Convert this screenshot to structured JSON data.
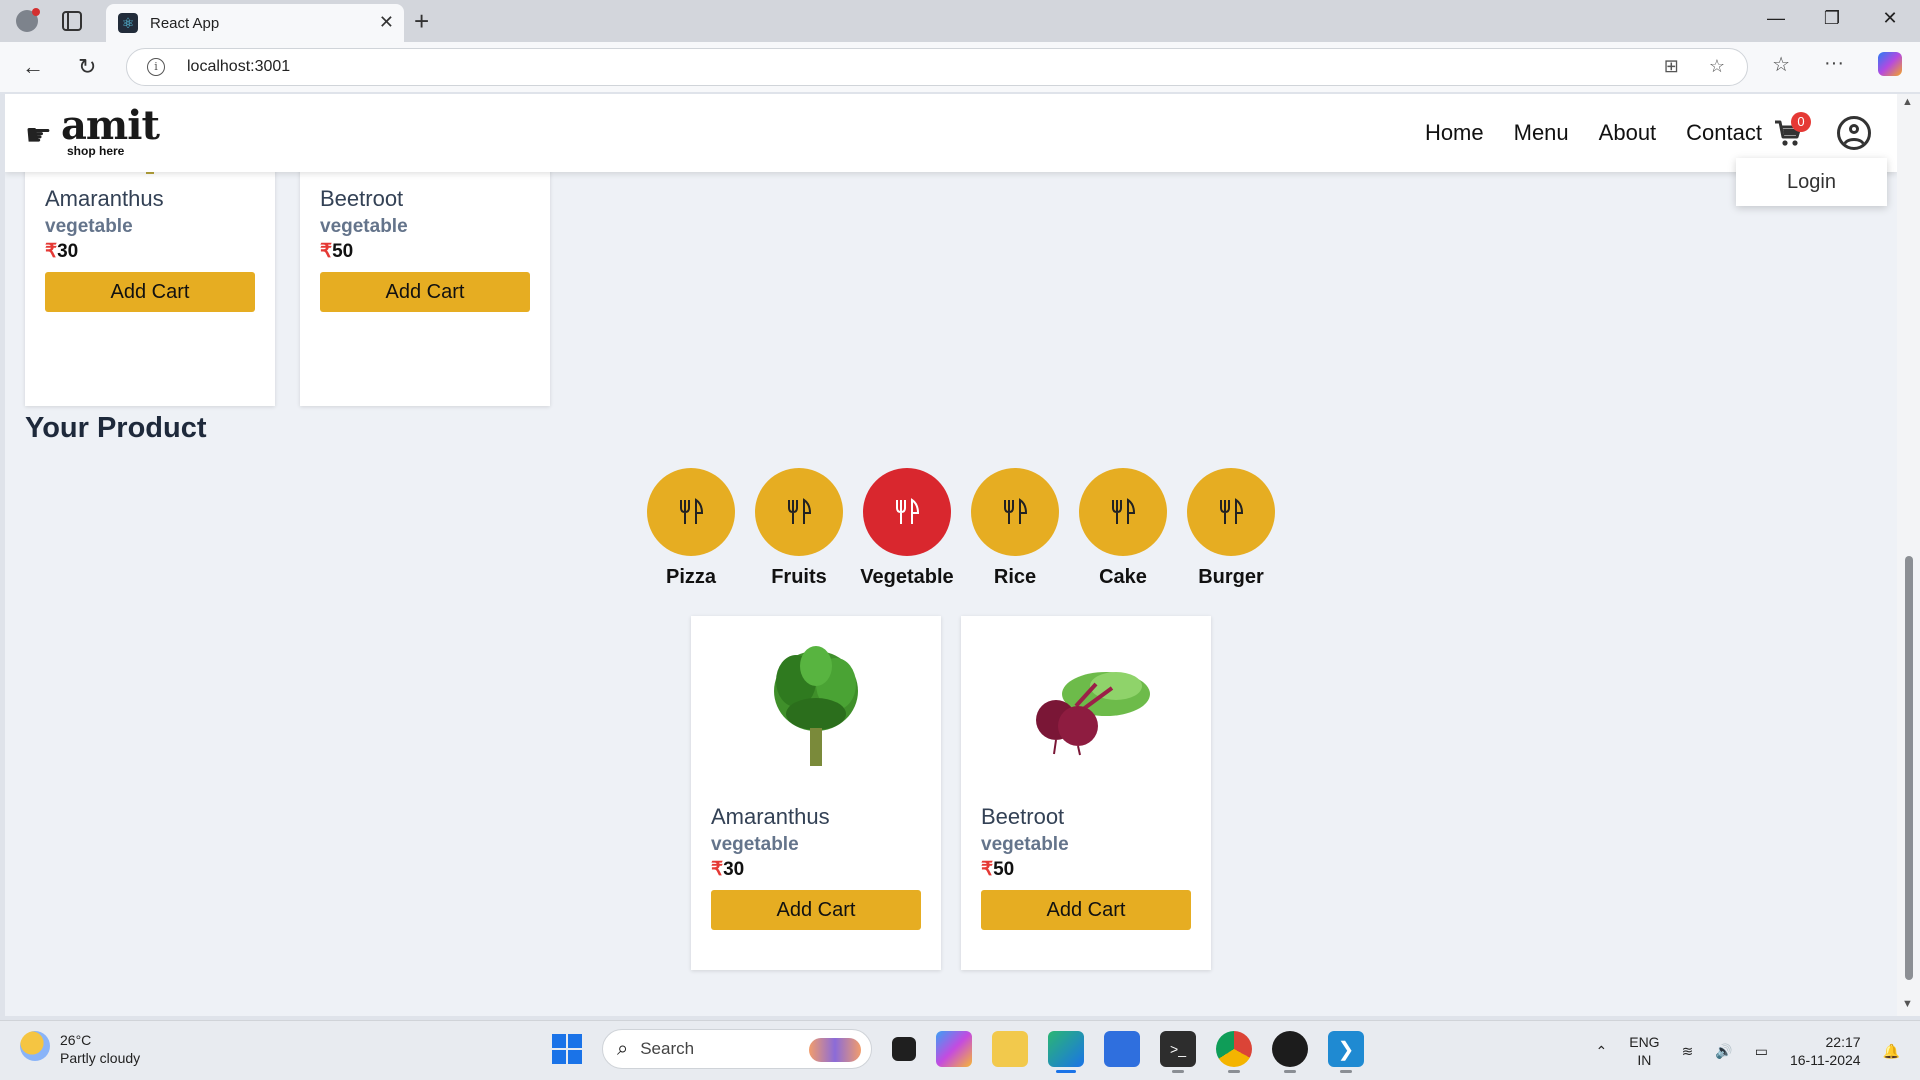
{
  "browser": {
    "tab_title": "React App",
    "url": "localhost:3001"
  },
  "header": {
    "logo_text": "amit",
    "logo_subtitle": "shop here",
    "nav": [
      "Home",
      "Menu",
      "About",
      "Contact"
    ],
    "cart_count": "0",
    "login_label": "Login"
  },
  "top_products": [
    {
      "name": "Amaranthus",
      "category": "vegetable",
      "currency": "₹",
      "price": "30",
      "button": "Add Cart"
    },
    {
      "name": "Beetroot",
      "category": "vegetable",
      "currency": "₹",
      "price": "50",
      "button": "Add Cart"
    }
  ],
  "your_product": {
    "title": "Your Product",
    "categories": [
      "Pizza",
      "Fruits",
      "Vegetable",
      "Rice",
      "Cake",
      "Burger"
    ],
    "active_category": "Vegetable",
    "products": [
      {
        "name": "Amaranthus",
        "category": "vegetable",
        "currency": "₹",
        "price": "30",
        "button": "Add Cart"
      },
      {
        "name": "Beetroot",
        "category": "vegetable",
        "currency": "₹",
        "price": "50",
        "button": "Add Cart"
      }
    ]
  },
  "colors": {
    "accent": "#e6ad22",
    "active_category": "#d9272e",
    "badge": "#e53935"
  },
  "taskbar": {
    "temperature": "26°C",
    "weather": "Partly cloudy",
    "search_placeholder": "Search",
    "language": "ENG",
    "region": "IN",
    "time": "22:17",
    "date": "16-11-2024"
  }
}
